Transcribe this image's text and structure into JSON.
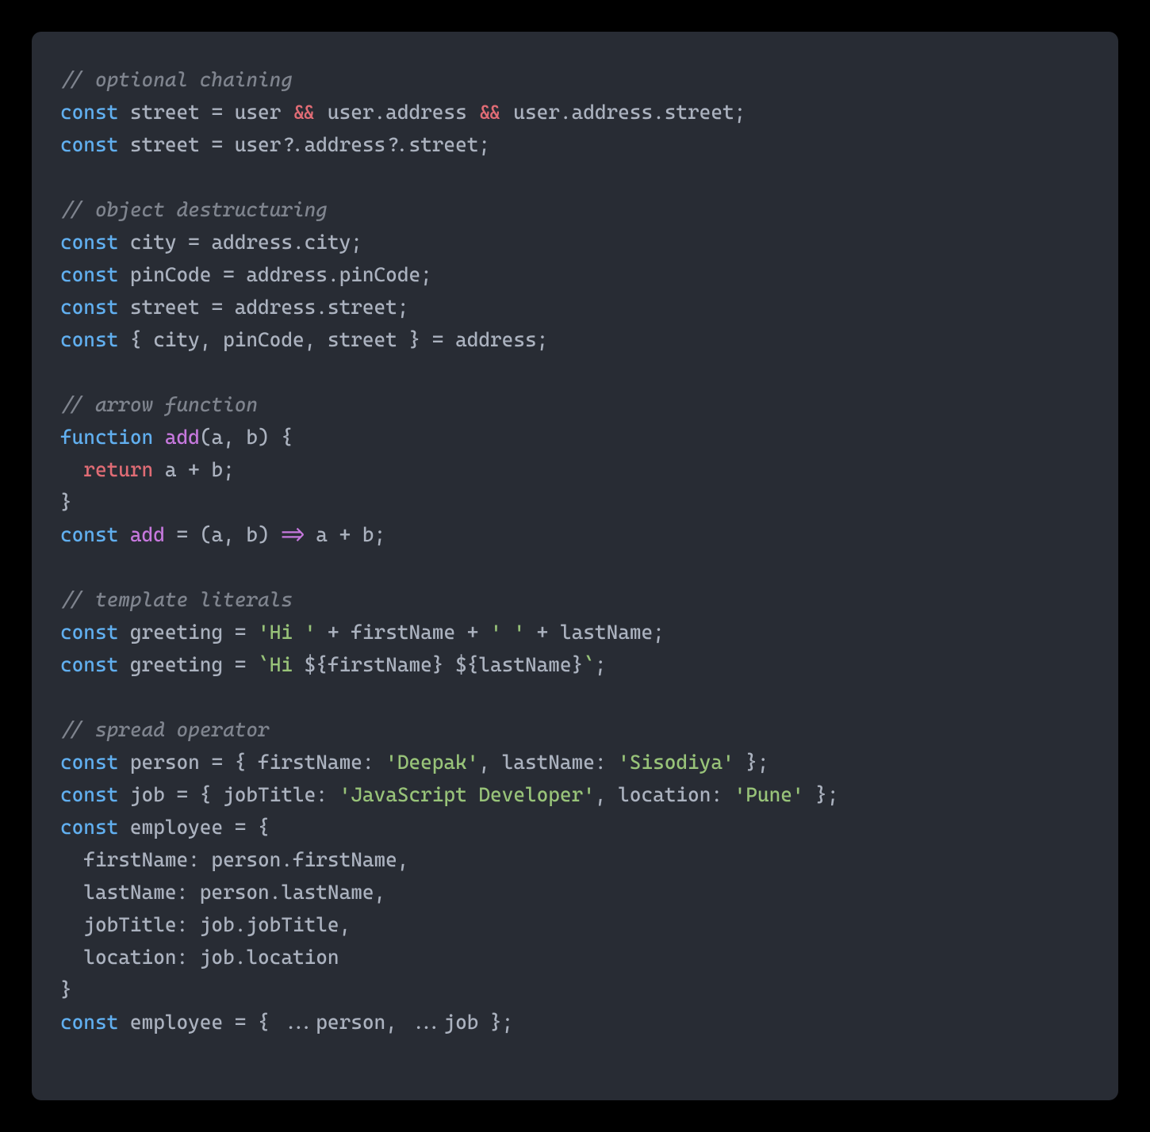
{
  "code": {
    "lines": [
      {
        "segments": [
          {
            "cls": "tok-comment",
            "text": "// optional chaining"
          }
        ]
      },
      {
        "segments": [
          {
            "cls": "tok-keyword",
            "text": "const"
          },
          {
            "cls": "tok-variable",
            "text": " street "
          },
          {
            "cls": "tok-operator",
            "text": "="
          },
          {
            "cls": "tok-variable",
            "text": " user "
          },
          {
            "cls": "tok-and",
            "text": "&&"
          },
          {
            "cls": "tok-variable",
            "text": " user.address "
          },
          {
            "cls": "tok-and",
            "text": "&&"
          },
          {
            "cls": "tok-variable",
            "text": " user.address.street;"
          }
        ]
      },
      {
        "segments": [
          {
            "cls": "tok-keyword",
            "text": "const"
          },
          {
            "cls": "tok-variable",
            "text": " street "
          },
          {
            "cls": "tok-operator",
            "text": "="
          },
          {
            "cls": "tok-variable",
            "text": " user?.address?.street;"
          }
        ]
      },
      {
        "segments": [
          {
            "cls": "tok-variable",
            "text": ""
          }
        ]
      },
      {
        "segments": [
          {
            "cls": "tok-comment",
            "text": "// object destructuring"
          }
        ]
      },
      {
        "segments": [
          {
            "cls": "tok-keyword",
            "text": "const"
          },
          {
            "cls": "tok-variable",
            "text": " city "
          },
          {
            "cls": "tok-operator",
            "text": "="
          },
          {
            "cls": "tok-variable",
            "text": " address.city;"
          }
        ]
      },
      {
        "segments": [
          {
            "cls": "tok-keyword",
            "text": "const"
          },
          {
            "cls": "tok-variable",
            "text": " pinCode "
          },
          {
            "cls": "tok-operator",
            "text": "="
          },
          {
            "cls": "tok-variable",
            "text": " address.pinCode;"
          }
        ]
      },
      {
        "segments": [
          {
            "cls": "tok-keyword",
            "text": "const"
          },
          {
            "cls": "tok-variable",
            "text": " street "
          },
          {
            "cls": "tok-operator",
            "text": "="
          },
          {
            "cls": "tok-variable",
            "text": " address.street;"
          }
        ]
      },
      {
        "segments": [
          {
            "cls": "tok-keyword",
            "text": "const"
          },
          {
            "cls": "tok-variable",
            "text": " { city, pinCode, street } "
          },
          {
            "cls": "tok-operator",
            "text": "="
          },
          {
            "cls": "tok-variable",
            "text": " address;"
          }
        ]
      },
      {
        "segments": [
          {
            "cls": "tok-variable",
            "text": ""
          }
        ]
      },
      {
        "segments": [
          {
            "cls": "tok-comment",
            "text": "// arrow function"
          }
        ]
      },
      {
        "segments": [
          {
            "cls": "tok-keyword",
            "text": "function"
          },
          {
            "cls": "tok-variable",
            "text": " "
          },
          {
            "cls": "tok-function-name",
            "text": "add"
          },
          {
            "cls": "tok-variable",
            "text": "(a, b) {"
          }
        ]
      },
      {
        "segments": [
          {
            "cls": "tok-variable",
            "text": "  "
          },
          {
            "cls": "tok-return",
            "text": "return"
          },
          {
            "cls": "tok-variable",
            "text": " a "
          },
          {
            "cls": "tok-operator",
            "text": "+"
          },
          {
            "cls": "tok-variable",
            "text": " b;"
          }
        ]
      },
      {
        "segments": [
          {
            "cls": "tok-variable",
            "text": "}"
          }
        ]
      },
      {
        "segments": [
          {
            "cls": "tok-keyword",
            "text": "const"
          },
          {
            "cls": "tok-variable",
            "text": " "
          },
          {
            "cls": "tok-function-name",
            "text": "add"
          },
          {
            "cls": "tok-variable",
            "text": " "
          },
          {
            "cls": "tok-operator",
            "text": "="
          },
          {
            "cls": "tok-variable",
            "text": " (a, b) "
          },
          {
            "cls": "tok-arrow",
            "text": "=>"
          },
          {
            "cls": "tok-variable",
            "text": " a "
          },
          {
            "cls": "tok-operator",
            "text": "+"
          },
          {
            "cls": "tok-variable",
            "text": " b;"
          }
        ]
      },
      {
        "segments": [
          {
            "cls": "tok-variable",
            "text": ""
          }
        ]
      },
      {
        "segments": [
          {
            "cls": "tok-comment",
            "text": "// template literals"
          }
        ]
      },
      {
        "segments": [
          {
            "cls": "tok-keyword",
            "text": "const"
          },
          {
            "cls": "tok-variable",
            "text": " greeting "
          },
          {
            "cls": "tok-operator",
            "text": "="
          },
          {
            "cls": "tok-variable",
            "text": " "
          },
          {
            "cls": "tok-string",
            "text": "'Hi '"
          },
          {
            "cls": "tok-variable",
            "text": " "
          },
          {
            "cls": "tok-operator",
            "text": "+"
          },
          {
            "cls": "tok-variable",
            "text": " firstName "
          },
          {
            "cls": "tok-operator",
            "text": "+"
          },
          {
            "cls": "tok-variable",
            "text": " "
          },
          {
            "cls": "tok-string",
            "text": "' '"
          },
          {
            "cls": "tok-variable",
            "text": " "
          },
          {
            "cls": "tok-operator",
            "text": "+"
          },
          {
            "cls": "tok-variable",
            "text": " lastName;"
          }
        ]
      },
      {
        "segments": [
          {
            "cls": "tok-keyword",
            "text": "const"
          },
          {
            "cls": "tok-variable",
            "text": " greeting "
          },
          {
            "cls": "tok-operator",
            "text": "="
          },
          {
            "cls": "tok-variable",
            "text": " "
          },
          {
            "cls": "tok-tmpl",
            "text": "`Hi "
          },
          {
            "cls": "tok-tmpl-expr",
            "text": "${firstName}"
          },
          {
            "cls": "tok-tmpl",
            "text": " "
          },
          {
            "cls": "tok-tmpl-expr",
            "text": "${lastName}"
          },
          {
            "cls": "tok-tmpl",
            "text": "`"
          },
          {
            "cls": "tok-variable",
            "text": ";"
          }
        ]
      },
      {
        "segments": [
          {
            "cls": "tok-variable",
            "text": ""
          }
        ]
      },
      {
        "segments": [
          {
            "cls": "tok-comment",
            "text": "// spread operator"
          }
        ]
      },
      {
        "segments": [
          {
            "cls": "tok-keyword",
            "text": "const"
          },
          {
            "cls": "tok-variable",
            "text": " person "
          },
          {
            "cls": "tok-operator",
            "text": "="
          },
          {
            "cls": "tok-variable",
            "text": " { firstName: "
          },
          {
            "cls": "tok-string",
            "text": "'Deepak'"
          },
          {
            "cls": "tok-variable",
            "text": ", lastName: "
          },
          {
            "cls": "tok-string",
            "text": "'Sisodiya'"
          },
          {
            "cls": "tok-variable",
            "text": " };"
          }
        ]
      },
      {
        "segments": [
          {
            "cls": "tok-keyword",
            "text": "const"
          },
          {
            "cls": "tok-variable",
            "text": " job "
          },
          {
            "cls": "tok-operator",
            "text": "="
          },
          {
            "cls": "tok-variable",
            "text": " { jobTitle: "
          },
          {
            "cls": "tok-string",
            "text": "'JavaScript Developer'"
          },
          {
            "cls": "tok-variable",
            "text": ", location: "
          },
          {
            "cls": "tok-string",
            "text": "'Pune'"
          },
          {
            "cls": "tok-variable",
            "text": " };"
          }
        ]
      },
      {
        "segments": [
          {
            "cls": "tok-keyword",
            "text": "const"
          },
          {
            "cls": "tok-variable",
            "text": " employee "
          },
          {
            "cls": "tok-operator",
            "text": "="
          },
          {
            "cls": "tok-variable",
            "text": " {"
          }
        ]
      },
      {
        "segments": [
          {
            "cls": "tok-variable",
            "text": "  firstName: person.firstName,"
          }
        ]
      },
      {
        "segments": [
          {
            "cls": "tok-variable",
            "text": "  lastName: person.lastName,"
          }
        ]
      },
      {
        "segments": [
          {
            "cls": "tok-variable",
            "text": "  jobTitle: job.jobTitle,"
          }
        ]
      },
      {
        "segments": [
          {
            "cls": "tok-variable",
            "text": "  location: job.location"
          }
        ]
      },
      {
        "segments": [
          {
            "cls": "tok-variable",
            "text": "}"
          }
        ]
      },
      {
        "segments": [
          {
            "cls": "tok-keyword",
            "text": "const"
          },
          {
            "cls": "tok-variable",
            "text": " employee "
          },
          {
            "cls": "tok-operator",
            "text": "="
          },
          {
            "cls": "tok-variable",
            "text": " { ...person, ...job };"
          }
        ]
      }
    ]
  }
}
